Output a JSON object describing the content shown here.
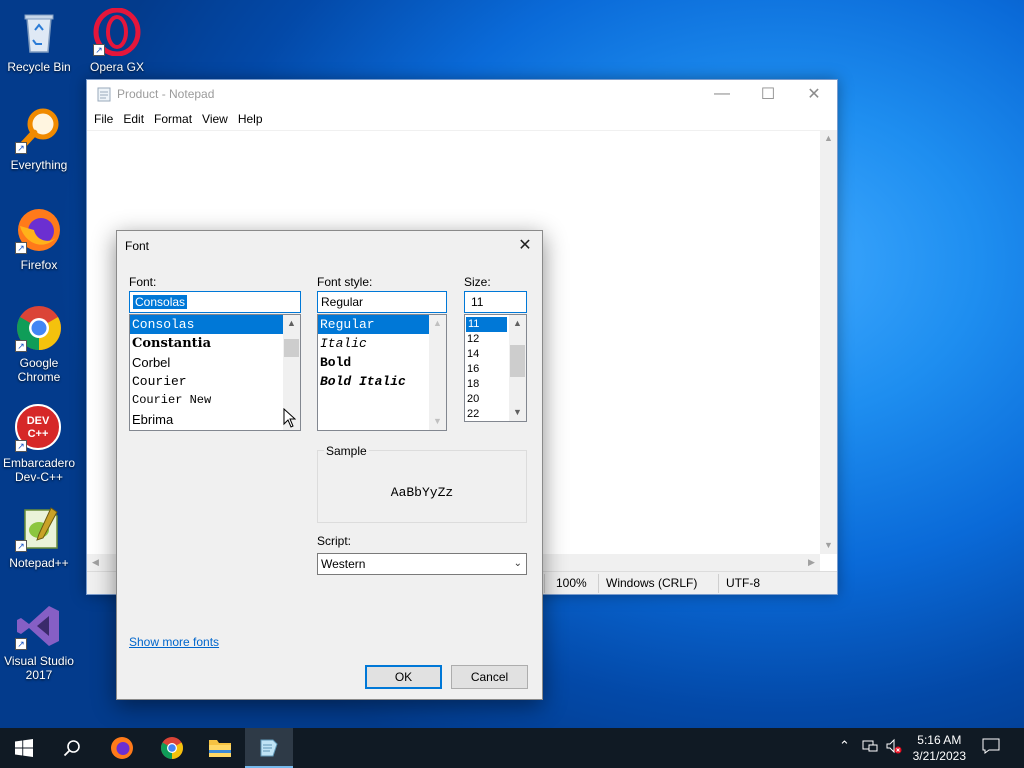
{
  "desktop": {
    "icons": [
      {
        "label": "Recycle Bin",
        "icon": "recycle-bin-icon"
      },
      {
        "label": "Opera GX",
        "icon": "opera-gx-icon"
      },
      {
        "label": "Everything",
        "icon": "everything-search-icon"
      },
      {
        "label": "Firefox",
        "icon": "firefox-icon"
      },
      {
        "label": "Google Chrome",
        "icon": "chrome-icon"
      },
      {
        "label": "Embarcadero Dev-C++",
        "icon": "devcpp-icon"
      },
      {
        "label": "Notepad++",
        "icon": "notepadpp-icon"
      },
      {
        "label": "Visual Studio 2017",
        "icon": "visual-studio-icon"
      }
    ],
    "devcpp_logo_text": "DEV C++"
  },
  "notepad": {
    "title": "Product - Notepad",
    "menu": [
      "File",
      "Edit",
      "Format",
      "View",
      "Help"
    ],
    "caption": {
      "minimize": "—",
      "maximize": "☐",
      "close": "✕"
    },
    "status": {
      "zoom": "100%",
      "line_ending": "Windows (CRLF)",
      "encoding": "UTF-8"
    }
  },
  "font_dialog": {
    "title": "Font",
    "close_glyph": "✕",
    "font": {
      "label": "Font:",
      "value": "Consolas",
      "items": [
        "Consolas",
        "Constantia",
        "Corbel",
        "Courier",
        "Courier New",
        "Ebrima"
      ],
      "selected": "Consolas"
    },
    "style": {
      "label": "Font style:",
      "value": "Regular",
      "items": [
        "Regular",
        "Italic",
        "Bold",
        "Bold Italic"
      ],
      "selected": "Regular"
    },
    "size": {
      "label": "Size:",
      "value": "11",
      "items": [
        "11",
        "12",
        "14",
        "16",
        "18",
        "20",
        "22"
      ],
      "selected": "11"
    },
    "sample": {
      "label": "Sample",
      "text": "AaBbYyZz"
    },
    "script": {
      "label": "Script:",
      "value": "Western"
    },
    "show_more_fonts": "Show more fonts",
    "ok": "OK",
    "cancel": "Cancel"
  },
  "taskbar": {
    "time": "5:16 AM",
    "date": "3/21/2023"
  },
  "colors": {
    "selection": "#0078d7",
    "link": "#0066cc",
    "taskbar": "#101a24"
  }
}
